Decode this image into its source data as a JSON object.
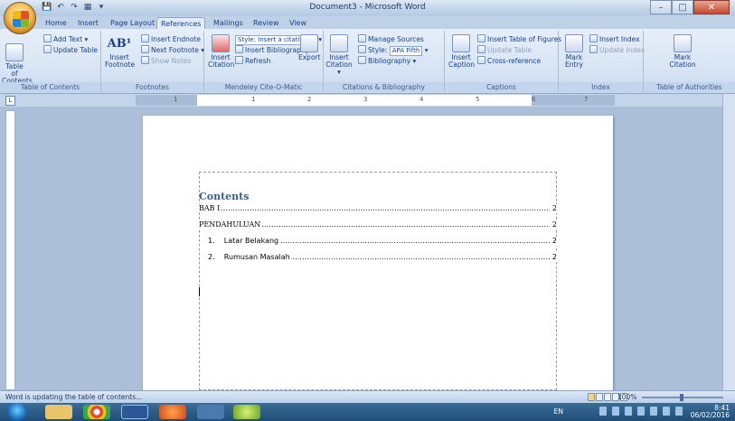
{
  "window": {
    "title": "Document3 - Microsoft Word"
  },
  "tabs": [
    "Home",
    "Insert",
    "Page Layout",
    "References",
    "Mailings",
    "Review",
    "View"
  ],
  "ribbon": {
    "toc": {
      "big_label_1": "Table of",
      "big_label_2": "Contents",
      "add_text": "Add Text",
      "update_table": "Update Table",
      "group": "Table of Contents"
    },
    "footnotes": {
      "insert_footnote_1": "Insert",
      "insert_footnote_2": "Footnote",
      "insert_endnote": "Insert Endnote",
      "next_footnote": "Next Footnote",
      "show_notes": "Show Notes",
      "group": "Footnotes"
    },
    "mendeley": {
      "insert_citation_1": "Insert",
      "insert_citation_2": "Citation",
      "style_label": "Style: Insert a citation...",
      "insert_bibliography": "Insert Bibliography",
      "refresh": "Refresh",
      "export": "Export",
      "group": "Mendeley Cite-O-Matic"
    },
    "citations": {
      "insert_citation_1": "Insert",
      "insert_citation_2": "Citation",
      "manage_sources": "Manage Sources",
      "style_prefix": "Style:",
      "style_value": "APA Fifth",
      "bibliography": "Bibliography",
      "group": "Citations & Bibliography"
    },
    "captions": {
      "insert_caption_1": "Insert",
      "insert_caption_2": "Caption",
      "insert_table_of_figures": "Insert Table of Figures",
      "update_table": "Update Table",
      "cross_reference": "Cross-reference",
      "group": "Captions"
    },
    "index": {
      "mark_entry_1": "Mark",
      "mark_entry_2": "Entry",
      "insert_index": "Insert Index",
      "update_index": "Update Index",
      "group": "Index"
    },
    "authorities": {
      "mark_citation_1": "Mark",
      "mark_citation_2": "Citation",
      "group": "Table of Authorities"
    }
  },
  "ruler": {
    "numbers": [
      "1",
      "1",
      "2",
      "3",
      "4",
      "5",
      "6",
      "7"
    ]
  },
  "document": {
    "toc_title": "Contents",
    "entries": [
      {
        "label": "BAB I",
        "page": "2"
      },
      {
        "label": "PENDAHULUAN",
        "page": "2"
      },
      {
        "label": "1.    Latar Belakang",
        "page": "2"
      },
      {
        "label": "2.    Rumusan Masalah",
        "page": "2"
      }
    ]
  },
  "status": {
    "message": "Word is updating the table of contents...",
    "zoom": "100%"
  },
  "taskbar": {
    "lang": "EN",
    "time": "8:41",
    "date": "06/02/2016"
  }
}
